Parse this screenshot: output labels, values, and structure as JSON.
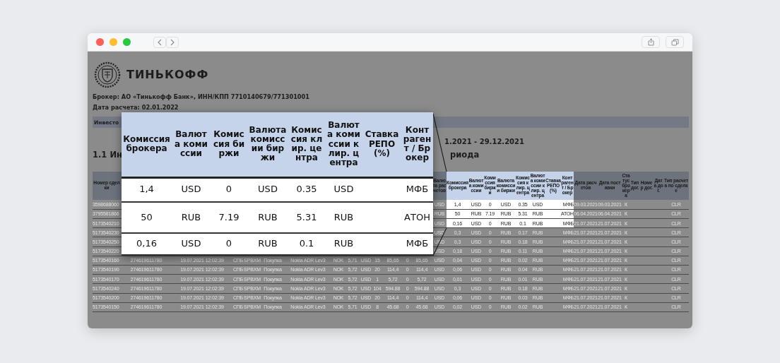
{
  "header": {
    "logo_text": "ТИНЬКОФФ",
    "broker": "Брокер: АО «Тинькофф Банк», ИНН/КПП 7710140679/771301001",
    "calc_date": "Дата расчета: 02.01.2022"
  },
  "section_bar": {
    "title": "Инвесто"
  },
  "period": "1.2021 - 29.12.2021",
  "heading": {
    "left": "1.1 Ин",
    "right": "риода"
  },
  "table": {
    "columns": [
      {
        "header": "Номер сделки",
        "highlighted": false
      },
      {
        "header": "Валюта расчетов",
        "highlighted": false
      },
      {
        "header": "Комиссия брокера",
        "highlighted": true
      },
      {
        "header": "Валюта комиссии",
        "highlighted": true
      },
      {
        "header": "Комиссия биржи",
        "highlighted": true
      },
      {
        "header": "Валюта комиссии биржи",
        "highlighted": true
      },
      {
        "header": "Комиссия клир. центра",
        "highlighted": true
      },
      {
        "header": "Валюта комиссии клир. центра",
        "highlighted": true
      },
      {
        "header": "Ставка РЕПО (%)",
        "highlighted": true
      },
      {
        "header": "Контрагент / Брокер",
        "highlighted": true
      },
      {
        "header": "Дата расчетов",
        "highlighted": false
      },
      {
        "header": "Дата поставки",
        "highlighted": false
      },
      {
        "header": "Статус брокера",
        "highlighted": false
      },
      {
        "header": "Тип дог.",
        "highlighted": false
      },
      {
        "header": "Номер дог.",
        "highlighted": false
      },
      {
        "header": "Дата дог.",
        "highlighted": false
      },
      {
        "header": "Тип расчета по сделке",
        "highlighted": false
      }
    ],
    "rows": [
      {
        "highlighted": true,
        "deal_number": "3598688060",
        "settlement_currency": "USD",
        "commissions": [
          "1,4",
          "USD",
          "0",
          "USD",
          "0.35",
          "USD"
        ],
        "counterparty": "МФБ",
        "settlement_date": "09.03.2021",
        "delivery_date": "09.03.2021",
        "broker_status": "К",
        "settlement_type": "CLR"
      },
      {
        "highlighted": true,
        "deal_number": "3795581866",
        "settlement_currency": "RUB",
        "commissions": [
          "50",
          "RUB",
          "7.19",
          "RUB",
          "5.31",
          "RUB"
        ],
        "counterparty": "АТОН",
        "settlement_date": "06.04.2021",
        "delivery_date": "06.04.2021",
        "broker_status": "К",
        "settlement_type": "CLR"
      },
      {
        "highlighted": true,
        "deal_number": "5173540210",
        "settlement_currency": "USD",
        "commissions": [
          "0,16",
          "USD",
          "0",
          "RUB",
          "0.1",
          "RUB"
        ],
        "counterparty": "МФБ",
        "settlement_date": "21.07.2021",
        "delivery_date": "21.07.2021",
        "broker_status": "К",
        "settlement_type": "CLR"
      },
      {
        "highlighted": false,
        "deal_number": "5173540230",
        "settlement_currency": "USD",
        "commissions": [
          "0,3",
          "USD",
          "0",
          "RUB",
          "0.17",
          "RUB"
        ],
        "counterparty": "МФБ",
        "settlement_date": "21.07.2021",
        "delivery_date": "21.07.2021",
        "broker_status": "К",
        "settlement_type": "CLR"
      },
      {
        "highlighted": false,
        "deal_number": "5173540250",
        "settlement_currency": "USD",
        "commissions": [
          "0,3",
          "USD",
          "0",
          "RUB",
          "0.18",
          "RUB"
        ],
        "counterparty": "МФБ",
        "settlement_date": "21.07.2021",
        "delivery_date": "21.07.2021",
        "broker_status": "К",
        "settlement_type": "CLR"
      },
      {
        "highlighted": false,
        "deal_number": "5173540220",
        "settlement_currency": "USD",
        "commissions": [
          "0,18",
          "USD",
          "0",
          "RUB",
          "0.11",
          "RUB"
        ],
        "counterparty": "МФБ",
        "settlement_date": "21.07.2021",
        "delivery_date": "21.07.2021",
        "broker_status": "К",
        "settlement_type": "CLR"
      },
      {
        "highlighted": false,
        "deal_number": "5173540160",
        "trade_details": [
          "274619611780",
          "19.07.2021 12:02:39",
          "СПБ",
          "SPBXM",
          "Покупка",
          "Nokia ADR Lev3",
          "NOK",
          "5,71",
          "USD",
          "15",
          "85,65",
          "0",
          "85,65"
        ],
        "settlement_currency": "USD",
        "commissions": [
          "0,04",
          "USD",
          "0",
          "RUB",
          "0.02",
          "RUB"
        ],
        "counterparty": "МФБ",
        "settlement_date": "21.07.2021",
        "delivery_date": "21.07.2021",
        "broker_status": "К",
        "settlement_type": "CLR"
      },
      {
        "highlighted": false,
        "deal_number": "5173540190",
        "trade_details": [
          "274619611780",
          "19.07.2021 12:02:39",
          "СПБ",
          "SPBXM",
          "Покупка",
          "Nokia ADR Lev3",
          "NOK",
          "5,72",
          "USD",
          "20",
          "114,4",
          "0",
          "114,4"
        ],
        "settlement_currency": "USD",
        "commissions": [
          "0,06",
          "USD",
          "0",
          "RUB",
          "0.04",
          "RUB"
        ],
        "counterparty": "МФБ",
        "settlement_date": "21.07.2021",
        "delivery_date": "21.07.2021",
        "broker_status": "К",
        "settlement_type": "CLR"
      },
      {
        "highlighted": false,
        "deal_number": "5173540170",
        "trade_details": [
          "274619611780",
          "19.07.2021 12:02:39",
          "СПБ",
          "SPBXM",
          "Покупка",
          "Nokia ADR Lev3",
          "NOK",
          "5,72",
          "USD",
          "1",
          "5,72",
          "0",
          "5,72"
        ],
        "settlement_currency": "USD",
        "commissions": [
          "0,01",
          "USD",
          "0",
          "RUB",
          "0.01",
          "RUB"
        ],
        "counterparty": "МФБ",
        "settlement_date": "21.07.2021",
        "delivery_date": "21.07.2021",
        "broker_status": "К",
        "settlement_type": "CLR"
      },
      {
        "highlighted": false,
        "deal_number": "5173540240",
        "trade_details": [
          "274619611780",
          "19.07.2021 12:02:39",
          "СПБ",
          "SPBXM",
          "Покупка",
          "Nokia ADR Lev3",
          "NOK",
          "5,72",
          "USD",
          "104",
          "594.88",
          "0",
          "594.88"
        ],
        "settlement_currency": "USD",
        "commissions": [
          "0,3",
          "USD",
          "0",
          "RUB",
          "0.18",
          "RUB"
        ],
        "counterparty": "МФБ",
        "settlement_date": "21.07.2021",
        "delivery_date": "21.07.2021",
        "broker_status": "К",
        "settlement_type": "CLR"
      },
      {
        "highlighted": false,
        "deal_number": "5173540200",
        "trade_details": [
          "274619611780",
          "19.07.2021 12:02:39",
          "СПБ",
          "SPBXM",
          "Покупка",
          "Nokia ADR Lev3",
          "NOK",
          "5,72",
          "USD",
          "20",
          "114,4",
          "0",
          "114,4"
        ],
        "settlement_currency": "USD",
        "commissions": [
          "0,06",
          "USD",
          "0",
          "RUB",
          "0.03",
          "RUB"
        ],
        "counterparty": "МФБ",
        "settlement_date": "21.07.2021",
        "delivery_date": "21.07.2021",
        "broker_status": "К",
        "settlement_type": "CLR"
      },
      {
        "highlighted": false,
        "deal_number": "5173540150",
        "trade_details": [
          "274619611780",
          "19.07.2021 12:02:39",
          "СПБ",
          "SPBXM",
          "Покупка",
          "Nokia ADR Lev3",
          "NOK",
          "5,71",
          "USD",
          "8",
          "45.68",
          "0",
          "45.68"
        ],
        "settlement_currency": "USD",
        "commissions": [
          "0,02",
          "USD",
          "0",
          "RUB",
          "0.02",
          "RUB"
        ],
        "counterparty": "МФБ",
        "settlement_date": "21.07.2021",
        "delivery_date": "21.07.2021",
        "broker_status": "К",
        "settlement_type": "CLR"
      }
    ]
  },
  "magnifier": {
    "columns": [
      "Комиссия брокера",
      "Валюта комиссии",
      "Комиссия биржи",
      "Валюта комиссии биржи",
      "Комиссия клир. центра",
      "Валюта комиссии клир. центра",
      "Ставка РЕПО (%)",
      "Контрагент / Брокер"
    ],
    "rows": [
      {
        "commissions": [
          "1,4",
          "USD",
          "0",
          "USD",
          "0.35",
          "USD"
        ],
        "counterparty": "МФБ"
      },
      {
        "commissions": [
          "50",
          "RUB",
          "7.19",
          "RUB",
          "5.31",
          "RUB"
        ],
        "counterparty": "АТОН"
      },
      {
        "commissions": [
          "0,16",
          "USD",
          "0",
          "RUB",
          "0.1",
          "RUB"
        ],
        "counterparty": "МФБ"
      }
    ]
  }
}
